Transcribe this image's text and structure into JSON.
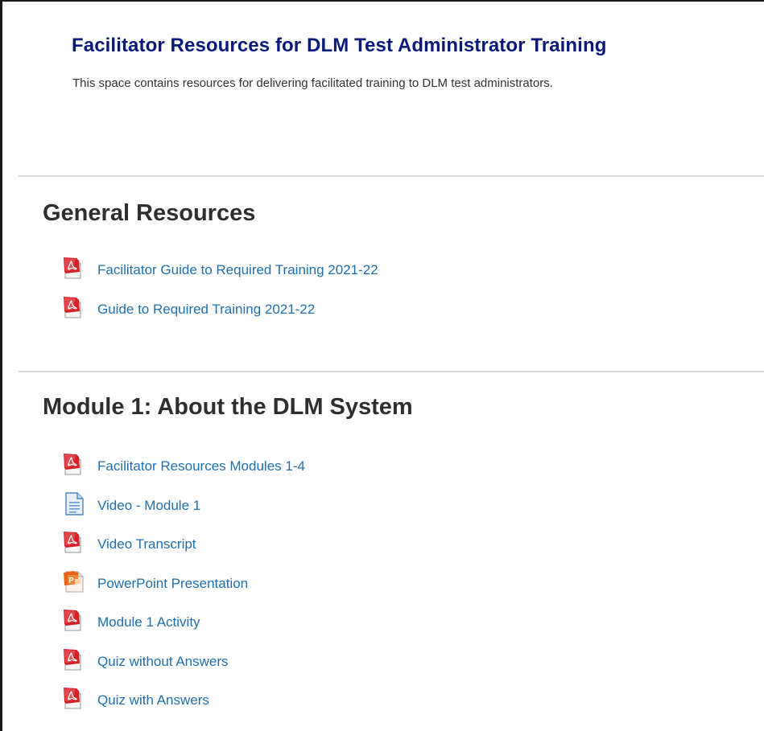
{
  "header": {
    "title": "Facilitator Resources for DLM Test Administrator Training",
    "subtitle": "This space contains resources for delivering facilitated training to DLM test administrators."
  },
  "sections": [
    {
      "heading": "General Resources",
      "files": [
        {
          "label": "Facilitator Guide to Required Training 2021-22",
          "icon": "pdf-icon"
        },
        {
          "label": "Guide to Required Training 2021-22",
          "icon": "pdf-icon"
        }
      ]
    },
    {
      "heading": "Module 1: About the DLM System",
      "files": [
        {
          "label": "Facilitator Resources Modules 1-4",
          "icon": "pdf-icon"
        },
        {
          "label": "Video - Module 1",
          "icon": "document-icon"
        },
        {
          "label": "Video Transcript",
          "icon": "pdf-icon"
        },
        {
          "label": "PowerPoint Presentation",
          "icon": "powerpoint-icon"
        },
        {
          "label": "Module 1 Activity",
          "icon": "pdf-icon"
        },
        {
          "label": "Quiz without Answers",
          "icon": "pdf-icon"
        },
        {
          "label": "Quiz with Answers",
          "icon": "pdf-icon"
        }
      ]
    }
  ],
  "colors": {
    "title": "#0b1a78",
    "link": "#1f6fb0",
    "heading": "#2e2e2e",
    "pdf_red": "#d2232a",
    "ppt_orange": "#e8641b",
    "doc_blue": "#4a86c8"
  }
}
